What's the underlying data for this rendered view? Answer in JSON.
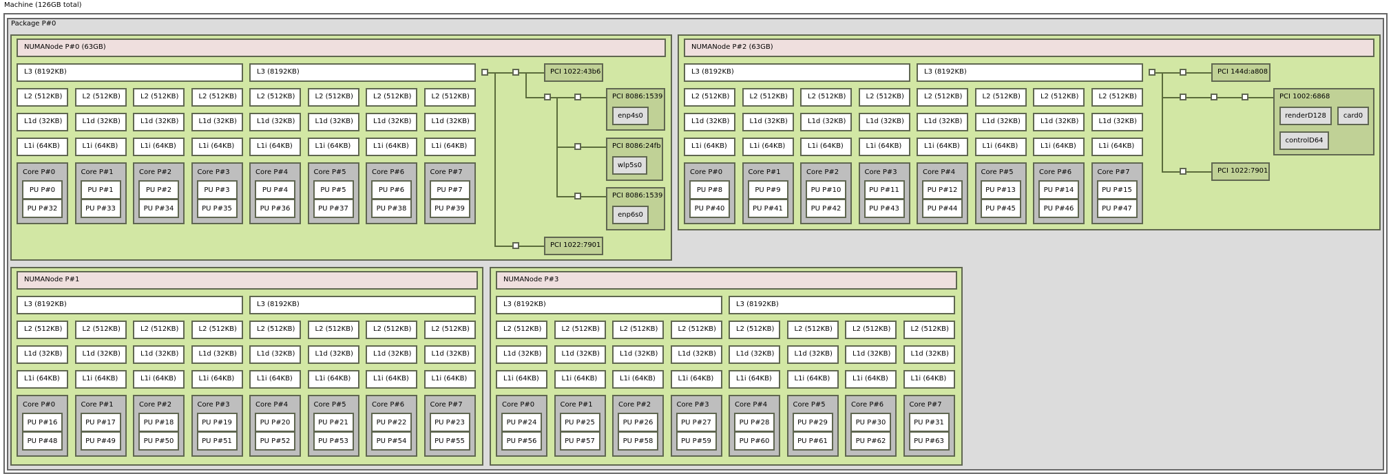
{
  "machine": {
    "label": "Machine (126GB total)"
  },
  "package": {
    "label": "Package P#0"
  },
  "colors": {
    "package": "#dcdcdc",
    "numa": "#d2e7a4",
    "memory": "#efdfde",
    "cache": "#ffffff",
    "core": "#bebebe",
    "pu": "#ffffff",
    "pci": "#c0d196",
    "osdev": "#dedede"
  },
  "numa_nodes": [
    {
      "label": "NUMANode P#0 (63GB)",
      "l3": [
        "L3 (8192KB)",
        "L3 (8192KB)"
      ],
      "l2": "L2 (512KB)",
      "l1d": "L1d (32KB)",
      "l1i": "L1i (64KB)",
      "cores": [
        {
          "label": "Core P#0",
          "pus": [
            "PU P#0",
            "PU P#32"
          ]
        },
        {
          "label": "Core P#1",
          "pus": [
            "PU P#1",
            "PU P#33"
          ]
        },
        {
          "label": "Core P#2",
          "pus": [
            "PU P#2",
            "PU P#34"
          ]
        },
        {
          "label": "Core P#3",
          "pus": [
            "PU P#3",
            "PU P#35"
          ]
        },
        {
          "label": "Core P#4",
          "pus": [
            "PU P#4",
            "PU P#36"
          ]
        },
        {
          "label": "Core P#5",
          "pus": [
            "PU P#5",
            "PU P#37"
          ]
        },
        {
          "label": "Core P#6",
          "pus": [
            "PU P#6",
            "PU P#38"
          ]
        },
        {
          "label": "Core P#7",
          "pus": [
            "PU P#7",
            "PU P#39"
          ]
        }
      ],
      "pci": [
        {
          "label": "PCI 1022:43b6",
          "osdevs": []
        },
        {
          "label": "PCI 8086:1539",
          "osdevs": [
            "enp4s0"
          ]
        },
        {
          "label": "PCI 8086:24fb",
          "osdevs": [
            "wlp5s0"
          ]
        },
        {
          "label": "PCI 8086:1539",
          "osdevs": [
            "enp6s0"
          ]
        },
        {
          "label": "PCI 1022:7901",
          "osdevs": []
        }
      ]
    },
    {
      "label": "NUMANode P#2 (63GB)",
      "l3": [
        "L3 (8192KB)",
        "L3 (8192KB)"
      ],
      "l2": "L2 (512KB)",
      "l1d": "L1d (32KB)",
      "l1i": "L1i (64KB)",
      "cores": [
        {
          "label": "Core P#0",
          "pus": [
            "PU P#8",
            "PU P#40"
          ]
        },
        {
          "label": "Core P#1",
          "pus": [
            "PU P#9",
            "PU P#41"
          ]
        },
        {
          "label": "Core P#2",
          "pus": [
            "PU P#10",
            "PU P#42"
          ]
        },
        {
          "label": "Core P#3",
          "pus": [
            "PU P#11",
            "PU P#43"
          ]
        },
        {
          "label": "Core P#4",
          "pus": [
            "PU P#12",
            "PU P#44"
          ]
        },
        {
          "label": "Core P#5",
          "pus": [
            "PU P#13",
            "PU P#45"
          ]
        },
        {
          "label": "Core P#6",
          "pus": [
            "PU P#14",
            "PU P#46"
          ]
        },
        {
          "label": "Core P#7",
          "pus": [
            "PU P#15",
            "PU P#47"
          ]
        }
      ],
      "pci": [
        {
          "label": "PCI 144d:a808",
          "osdevs": []
        },
        {
          "label": "PCI 1002:6868",
          "osdevs": [
            "renderD128",
            "card0",
            "controlD64"
          ]
        },
        {
          "label": "PCI 1022:7901",
          "osdevs": []
        }
      ]
    },
    {
      "label": "NUMANode P#1",
      "l3": [
        "L3 (8192KB)",
        "L3 (8192KB)"
      ],
      "l2": "L2 (512KB)",
      "l1d": "L1d (32KB)",
      "l1i": "L1i (64KB)",
      "cores": [
        {
          "label": "Core P#0",
          "pus": [
            "PU P#16",
            "PU P#48"
          ]
        },
        {
          "label": "Core P#1",
          "pus": [
            "PU P#17",
            "PU P#49"
          ]
        },
        {
          "label": "Core P#2",
          "pus": [
            "PU P#18",
            "PU P#50"
          ]
        },
        {
          "label": "Core P#3",
          "pus": [
            "PU P#19",
            "PU P#51"
          ]
        },
        {
          "label": "Core P#4",
          "pus": [
            "PU P#20",
            "PU P#52"
          ]
        },
        {
          "label": "Core P#5",
          "pus": [
            "PU P#21",
            "PU P#53"
          ]
        },
        {
          "label": "Core P#6",
          "pus": [
            "PU P#22",
            "PU P#54"
          ]
        },
        {
          "label": "Core P#7",
          "pus": [
            "PU P#23",
            "PU P#55"
          ]
        }
      ],
      "pci": []
    },
    {
      "label": "NUMANode P#3",
      "l3": [
        "L3 (8192KB)",
        "L3 (8192KB)"
      ],
      "l2": "L2 (512KB)",
      "l1d": "L1d (32KB)",
      "l1i": "L1i (64KB)",
      "cores": [
        {
          "label": "Core P#0",
          "pus": [
            "PU P#24",
            "PU P#56"
          ]
        },
        {
          "label": "Core P#1",
          "pus": [
            "PU P#25",
            "PU P#57"
          ]
        },
        {
          "label": "Core P#2",
          "pus": [
            "PU P#26",
            "PU P#58"
          ]
        },
        {
          "label": "Core P#3",
          "pus": [
            "PU P#27",
            "PU P#59"
          ]
        },
        {
          "label": "Core P#4",
          "pus": [
            "PU P#28",
            "PU P#60"
          ]
        },
        {
          "label": "Core P#5",
          "pus": [
            "PU P#29",
            "PU P#61"
          ]
        },
        {
          "label": "Core P#6",
          "pus": [
            "PU P#30",
            "PU P#62"
          ]
        },
        {
          "label": "Core P#7",
          "pus": [
            "PU P#31",
            "PU P#63"
          ]
        }
      ],
      "pci": []
    }
  ]
}
